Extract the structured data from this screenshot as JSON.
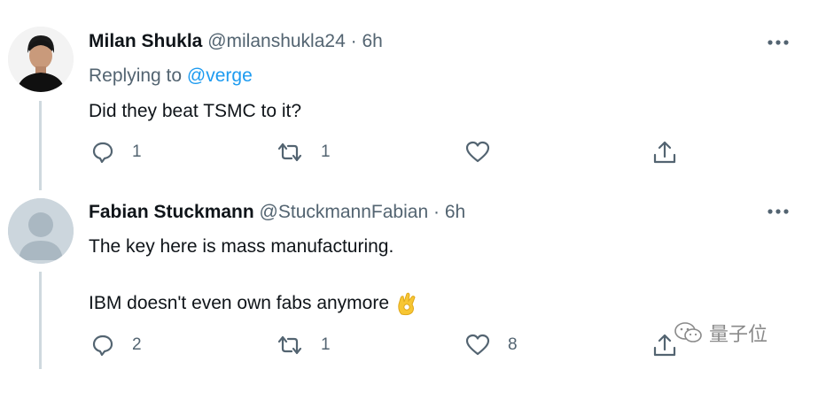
{
  "tweets": [
    {
      "display_name": "Milan Shukla",
      "handle": "@milanshukla24",
      "separator": "·",
      "time": "6h",
      "replying_prefix": "Replying to",
      "replying_to": "@verge",
      "text": "Did they beat TSMC to it?",
      "reply_count": "1",
      "retweet_count": "1",
      "like_count": ""
    },
    {
      "display_name": "Fabian Stuckmann",
      "handle": "@StuckmannFabian",
      "separator": "·",
      "time": "6h",
      "text_line1": "The key here is mass manufacturing.",
      "text_line2": "IBM doesn't even own fabs anymore",
      "emoji": "ok-hand-emoji",
      "reply_count": "2",
      "retweet_count": "1",
      "like_count": "8"
    }
  ],
  "watermark": {
    "text": "量子位",
    "icon": "wechat-icon"
  },
  "colors": {
    "link": "#1d9bf0",
    "secondary": "#536471",
    "line": "#cfd9de"
  }
}
